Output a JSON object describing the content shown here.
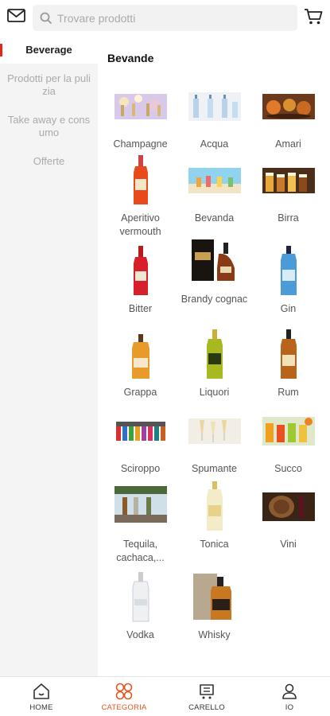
{
  "search": {
    "placeholder": "Trovare prodotti"
  },
  "sidebar": {
    "items": [
      {
        "label": "Beverage",
        "active": true
      },
      {
        "label": "Prodotti per la pulizia",
        "active": false
      },
      {
        "label": "Take away e consumo",
        "active": false
      },
      {
        "label": "Offerte",
        "active": false
      }
    ]
  },
  "main": {
    "title": "Bevande",
    "products": [
      {
        "label": "Champagne",
        "icon": "champagne-image"
      },
      {
        "label": "Acqua",
        "icon": "water-image"
      },
      {
        "label": "Amari",
        "icon": "amari-image"
      },
      {
        "label": "Aperitivo vermouth",
        "icon": "aperitivo-bottle-image"
      },
      {
        "label": "Bevanda",
        "icon": "beverage-beach-image"
      },
      {
        "label": "Birra",
        "icon": "beer-glasses-image"
      },
      {
        "label": "Bitter",
        "icon": "bitter-bottle-image"
      },
      {
        "label": "Brandy cognac",
        "icon": "cognac-box-image"
      },
      {
        "label": "Gin",
        "icon": "gin-bottle-image"
      },
      {
        "label": "Grappa",
        "icon": "grappa-bottle-image"
      },
      {
        "label": "Liquori",
        "icon": "liqueur-bottle-image"
      },
      {
        "label": "Rum",
        "icon": "rum-bottle-image"
      },
      {
        "label": "Sciroppo",
        "icon": "syrup-bottles-image"
      },
      {
        "label": "Spumante",
        "icon": "sparkling-glasses-image"
      },
      {
        "label": "Succo",
        "icon": "juice-glasses-image"
      },
      {
        "label": "Tequila, cachaca,...",
        "icon": "tequila-bar-image"
      },
      {
        "label": "Tonica",
        "icon": "tonic-bottle-image"
      },
      {
        "label": "Vini",
        "icon": "wine-barrel-image"
      },
      {
        "label": "Vodka",
        "icon": "vodka-bottle-image"
      },
      {
        "label": "Whisky",
        "icon": "whisky-box-image"
      }
    ]
  },
  "bottom_nav": {
    "items": [
      {
        "label": "HOME",
        "icon": "home-icon"
      },
      {
        "label": "CATEGORIA",
        "icon": "category-icon",
        "active": true
      },
      {
        "label": "CARELLO",
        "icon": "cart-icon"
      },
      {
        "label": "IO",
        "icon": "profile-icon"
      }
    ]
  },
  "colors": {
    "accent": "#e8531c",
    "active_marker": "#e8231c",
    "sidebar_bg": "#f4f4f4"
  }
}
